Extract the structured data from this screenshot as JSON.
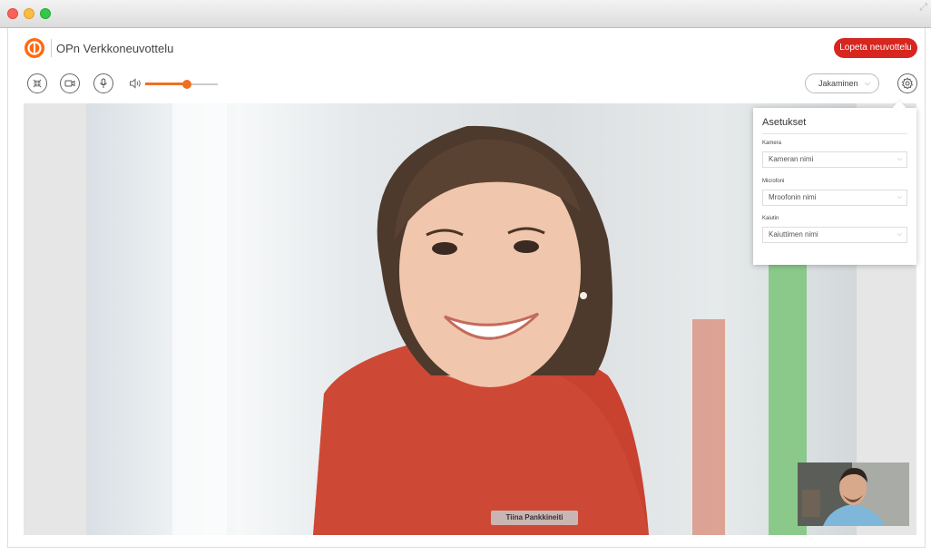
{
  "app": {
    "title": "OPn Verkkoneuvottelu"
  },
  "header": {
    "end_call_label": "Lopeta neuvottelu"
  },
  "toolbar": {
    "volume_percent": 58,
    "share_label": "Jakaminen"
  },
  "video": {
    "participant_name": "Tiina Pankkineiti"
  },
  "settings": {
    "title": "Asetukset",
    "camera_label": "Kamera",
    "camera_value": "Kameran nimi",
    "microphone_label": "Microfoni",
    "microphone_value": "Mroofonin nimi",
    "speaker_label": "Kaiutin",
    "speaker_value": "Kaiuttimen nimi"
  },
  "colors": {
    "brand": "#ff6a10",
    "end_call": "#d6261f",
    "accent": "#f07021"
  }
}
